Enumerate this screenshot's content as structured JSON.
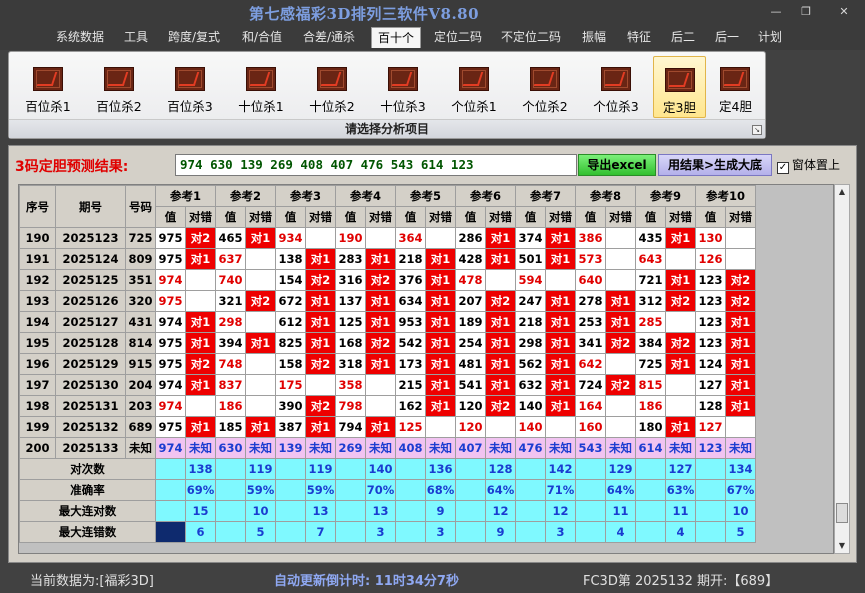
{
  "window": {
    "title": "第七感福彩3D排列三软件V8.80",
    "min_glyph": "—",
    "max_glyph": "❐",
    "close_glyph": "✕"
  },
  "menu": [
    {
      "label": "系统数据"
    },
    {
      "label": "工具"
    },
    {
      "label": "跨度/复式"
    },
    {
      "label": "和/合值"
    },
    {
      "label": "合差/通杀"
    },
    {
      "label": "百十个"
    },
    {
      "label": "定位二码"
    },
    {
      "label": "不定位二码"
    },
    {
      "label": "振幅"
    },
    {
      "label": "特征"
    },
    {
      "label": "后二"
    },
    {
      "label": "后一"
    },
    {
      "label": "计划"
    }
  ],
  "menu_active": 5,
  "ribbon": {
    "buttons": [
      {
        "label": "百位杀1",
        "icon": "chart-icon"
      },
      {
        "label": "百位杀2",
        "icon": "chart-icon"
      },
      {
        "label": "百位杀3",
        "icon": "chart-icon"
      },
      {
        "label": "十位杀1",
        "icon": "chart-icon"
      },
      {
        "label": "十位杀2",
        "icon": "chart-icon"
      },
      {
        "label": "十位杀3",
        "icon": "chart-icon"
      },
      {
        "label": "个位杀1",
        "icon": "chart-icon"
      },
      {
        "label": "个位杀2",
        "icon": "chart-icon"
      },
      {
        "label": "个位杀3",
        "icon": "chart-icon"
      },
      {
        "label": "定3胆",
        "icon": "chart-icon"
      },
      {
        "label": "定4胆",
        "icon": "chart-icon"
      }
    ],
    "selected": 9,
    "group_label": "请选择分析项目",
    "launcher_glyph": "↘"
  },
  "prediction": {
    "label": "3码定胆预测结果:",
    "value": "974 630 139 269 408 407 476 543 614 123",
    "excel_button": "导出excel",
    "generate_button": "用结果>生成大底",
    "on_top_label": "窗体置上",
    "on_top_checked": "✓"
  },
  "grid": {
    "headers": {
      "seq": "序号",
      "period": "期号",
      "code": "号码",
      "val": "值",
      "mark": "对错",
      "refs": [
        "参考1",
        "参考2",
        "参考3",
        "参考4",
        "参考5",
        "参考6",
        "参考7",
        "参考8",
        "参考9",
        "参考10"
      ]
    },
    "rows": [
      {
        "seq": "190",
        "period": "2025123",
        "code": "725",
        "cells": [
          [
            "975",
            "对2"
          ],
          [
            "465",
            "对1"
          ],
          [
            "934",
            ""
          ],
          [
            "190",
            ""
          ],
          [
            "364",
            ""
          ],
          [
            "286",
            "对1"
          ],
          [
            "374",
            "对1"
          ],
          [
            "386",
            ""
          ],
          [
            "435",
            "对1"
          ],
          [
            "130",
            ""
          ]
        ]
      },
      {
        "seq": "191",
        "period": "2025124",
        "code": "809",
        "cells": [
          [
            "975",
            "对1"
          ],
          [
            "637",
            ""
          ],
          [
            "138",
            "对1"
          ],
          [
            "283",
            "对1"
          ],
          [
            "218",
            "对1"
          ],
          [
            "428",
            "对1"
          ],
          [
            "501",
            "对1"
          ],
          [
            "573",
            ""
          ],
          [
            "643",
            ""
          ],
          [
            "126",
            ""
          ]
        ]
      },
      {
        "seq": "192",
        "period": "2025125",
        "code": "351",
        "cells": [
          [
            "974",
            ""
          ],
          [
            "740",
            ""
          ],
          [
            "154",
            "对2"
          ],
          [
            "316",
            "对2"
          ],
          [
            "376",
            "对1"
          ],
          [
            "478",
            ""
          ],
          [
            "594",
            ""
          ],
          [
            "640",
            ""
          ],
          [
            "721",
            "对1"
          ],
          [
            "123",
            "对2"
          ]
        ]
      },
      {
        "seq": "193",
        "period": "2025126",
        "code": "320",
        "cells": [
          [
            "975",
            ""
          ],
          [
            "321",
            "对2"
          ],
          [
            "672",
            "对1"
          ],
          [
            "137",
            "对1"
          ],
          [
            "634",
            "对1"
          ],
          [
            "207",
            "对2"
          ],
          [
            "247",
            "对1"
          ],
          [
            "278",
            "对1"
          ],
          [
            "312",
            "对2"
          ],
          [
            "123",
            "对2"
          ]
        ]
      },
      {
        "seq": "194",
        "period": "2025127",
        "code": "431",
        "cells": [
          [
            "974",
            "对1"
          ],
          [
            "298",
            ""
          ],
          [
            "612",
            "对1"
          ],
          [
            "125",
            "对1"
          ],
          [
            "953",
            "对1"
          ],
          [
            "189",
            "对1"
          ],
          [
            "218",
            "对1"
          ],
          [
            "253",
            "对1"
          ],
          [
            "285",
            ""
          ],
          [
            "123",
            "对1"
          ]
        ]
      },
      {
        "seq": "195",
        "period": "2025128",
        "code": "814",
        "cells": [
          [
            "975",
            "对1"
          ],
          [
            "394",
            "对1"
          ],
          [
            "825",
            "对1"
          ],
          [
            "168",
            "对2"
          ],
          [
            "542",
            "对1"
          ],
          [
            "254",
            "对1"
          ],
          [
            "298",
            "对1"
          ],
          [
            "341",
            "对2"
          ],
          [
            "384",
            "对2"
          ],
          [
            "123",
            "对1"
          ]
        ]
      },
      {
        "seq": "196",
        "period": "2025129",
        "code": "915",
        "cells": [
          [
            "975",
            "对2"
          ],
          [
            "748",
            ""
          ],
          [
            "158",
            "对2"
          ],
          [
            "318",
            "对1"
          ],
          [
            "173",
            "对1"
          ],
          [
            "481",
            "对1"
          ],
          [
            "562",
            "对1"
          ],
          [
            "642",
            ""
          ],
          [
            "725",
            "对1"
          ],
          [
            "124",
            "对1"
          ]
        ]
      },
      {
        "seq": "197",
        "period": "2025130",
        "code": "204",
        "cells": [
          [
            "974",
            "对1"
          ],
          [
            "837",
            ""
          ],
          [
            "175",
            ""
          ],
          [
            "358",
            ""
          ],
          [
            "215",
            "对1"
          ],
          [
            "541",
            "对1"
          ],
          [
            "632",
            "对1"
          ],
          [
            "724",
            "对2"
          ],
          [
            "815",
            ""
          ],
          [
            "127",
            "对1"
          ]
        ]
      },
      {
        "seq": "198",
        "period": "2025131",
        "code": "203",
        "cells": [
          [
            "974",
            ""
          ],
          [
            "186",
            ""
          ],
          [
            "390",
            "对2"
          ],
          [
            "798",
            ""
          ],
          [
            "162",
            "对1"
          ],
          [
            "120",
            "对2"
          ],
          [
            "140",
            "对1"
          ],
          [
            "164",
            ""
          ],
          [
            "186",
            ""
          ],
          [
            "128",
            "对1"
          ]
        ]
      },
      {
        "seq": "199",
        "period": "2025132",
        "code": "689",
        "cells": [
          [
            "975",
            "对1"
          ],
          [
            "185",
            "对1"
          ],
          [
            "387",
            "对1"
          ],
          [
            "794",
            "对1"
          ],
          [
            "125",
            ""
          ],
          [
            "120",
            ""
          ],
          [
            "140",
            ""
          ],
          [
            "160",
            ""
          ],
          [
            "180",
            "对1"
          ],
          [
            "127",
            ""
          ]
        ]
      }
    ],
    "pred_row": {
      "seq": "200",
      "period": "2025133",
      "code": "未知",
      "cells": [
        [
          "974",
          "未知"
        ],
        [
          "630",
          "未知"
        ],
        [
          "139",
          "未知"
        ],
        [
          "269",
          "未知"
        ],
        [
          "408",
          "未知"
        ],
        [
          "407",
          "未知"
        ],
        [
          "476",
          "未知"
        ],
        [
          "543",
          "未知"
        ],
        [
          "614",
          "未知"
        ],
        [
          "123",
          "未知"
        ]
      ]
    },
    "stats": [
      {
        "label": "对次数",
        "values": [
          "138",
          "119",
          "119",
          "140",
          "136",
          "128",
          "142",
          "129",
          "127",
          "134"
        ]
      },
      {
        "label": "准确率",
        "values": [
          "69%",
          "59%",
          "59%",
          "70%",
          "68%",
          "64%",
          "71%",
          "64%",
          "63%",
          "67%"
        ]
      },
      {
        "label": "最大连对数",
        "values": [
          "15",
          "10",
          "13",
          "13",
          "9",
          "12",
          "12",
          "11",
          "11",
          "10"
        ]
      },
      {
        "label": "最大连错数",
        "values": [
          "6",
          "5",
          "7",
          "3",
          "3",
          "9",
          "3",
          "4",
          "4",
          "5"
        ]
      }
    ],
    "hit_color": "#ee0000",
    "stat_color": "#7ff9ff",
    "pred_color": "#f1c3f1"
  },
  "scrollbar": {
    "up_glyph": "▲",
    "down_glyph": "▼"
  },
  "status": {
    "current_data": "当前数据为:[福彩3D]",
    "countdown": "自动更新倒计时:  11时34分7秒",
    "issue": "FC3D第 2025132 期开:【689】"
  }
}
